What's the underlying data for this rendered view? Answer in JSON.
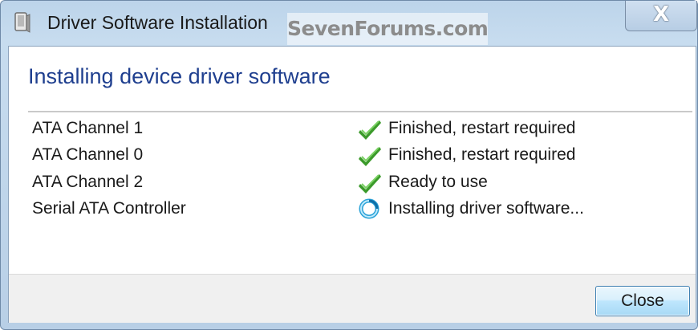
{
  "window": {
    "title": "Driver Software Installation",
    "watermark": "SevenForums.com",
    "close_glyph": "X",
    "title_icon": "driver-installer-icon"
  },
  "main": {
    "heading": "Installing device driver software",
    "devices": [
      {
        "name": "ATA Channel 1",
        "status": "Finished, restart required",
        "icon": "checkmark-icon"
      },
      {
        "name": "ATA Channel 0",
        "status": "Finished, restart required",
        "icon": "checkmark-icon"
      },
      {
        "name": "ATA Channel 2",
        "status": "Ready to use",
        "icon": "checkmark-icon"
      },
      {
        "name": "Serial ATA Controller",
        "status": "Installing driver software...",
        "icon": "busy-spinner-icon"
      }
    ]
  },
  "footer": {
    "close_label": "Close"
  },
  "colors": {
    "heading": "#1f3f8f",
    "check": "#3b9a2a",
    "spinner": "#2ba3d8",
    "button_border": "#3c7fb1"
  }
}
